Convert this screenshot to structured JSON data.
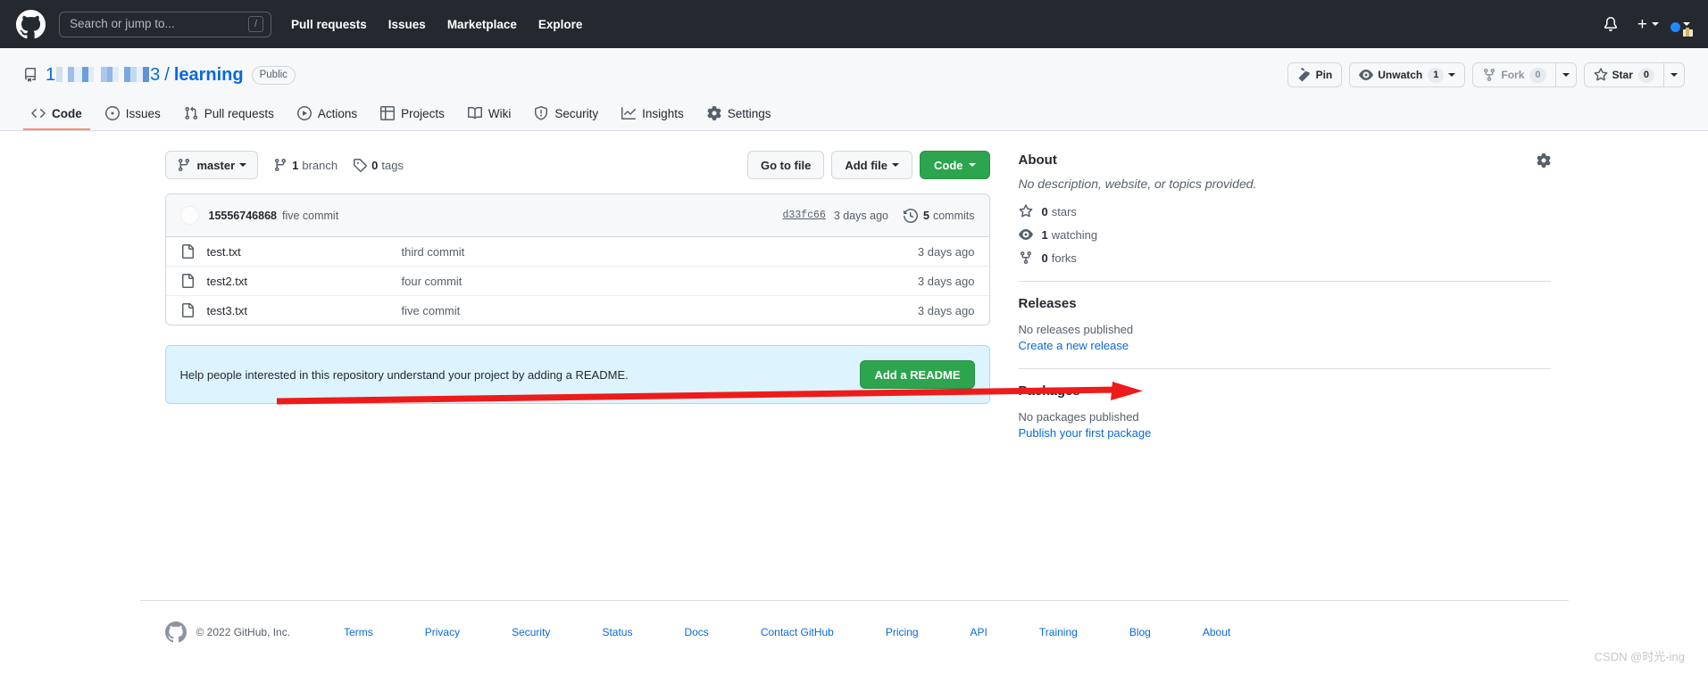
{
  "header": {
    "logo_icon": "github-mark-icon",
    "search": {
      "placeholder": "Search or jump to...",
      "value": "",
      "shortcut_key": "/"
    },
    "nav": [
      {
        "label": "Pull requests"
      },
      {
        "label": "Issues"
      },
      {
        "label": "Marketplace"
      },
      {
        "label": "Explore"
      }
    ],
    "notifications_icon": "bell-icon",
    "create_new_icon": "plus-icon",
    "create_new_caret": "chevron-down-icon",
    "avatar_icon": "user-avatar",
    "avatar_caret": "chevron-down-icon"
  },
  "repo": {
    "repo_icon": "repo-icon",
    "owner": "1███████3",
    "owner_prefix": "1",
    "owner_suffix": "3",
    "separator": "/",
    "name": "learning",
    "visibility": "Public",
    "actions": {
      "pin_label": "Pin",
      "pin_icon": "pin-icon",
      "unwatch_label": "Unwatch",
      "unwatch_icon": "eye-icon",
      "unwatch_count": "1",
      "fork_label": "Fork",
      "fork_icon": "repo-forked-icon",
      "fork_count": "0",
      "star_label": "Star",
      "star_icon": "star-icon",
      "star_count": "0"
    },
    "tabs": [
      {
        "label": "Code",
        "icon": "code-icon",
        "active": true
      },
      {
        "label": "Issues",
        "icon": "issue-opened-icon",
        "active": false
      },
      {
        "label": "Pull requests",
        "icon": "git-pull-request-icon",
        "active": false
      },
      {
        "label": "Actions",
        "icon": "play-icon",
        "active": false
      },
      {
        "label": "Projects",
        "icon": "table-icon",
        "active": false
      },
      {
        "label": "Wiki",
        "icon": "book-icon",
        "active": false
      },
      {
        "label": "Security",
        "icon": "shield-icon",
        "active": false
      },
      {
        "label": "Insights",
        "icon": "graph-icon",
        "active": false
      },
      {
        "label": "Settings",
        "icon": "gear-icon",
        "active": false
      }
    ]
  },
  "toolbar": {
    "branch_name": "master",
    "branch_icon": "git-branch-icon",
    "branch_caret": "chevron-down-icon",
    "branch_count": "1",
    "branch_count_label": "branch",
    "tag_count": "0",
    "tag_count_label": "tags",
    "tag_icon": "tag-icon",
    "go_to_file": "Go to file",
    "add_file": "Add file",
    "code_button": "Code"
  },
  "commit_bar": {
    "avatar": "commit-author-avatar",
    "author": "15556746868",
    "message": "five commit",
    "sha": "d33fc66",
    "time": "3 days ago",
    "history_icon": "history-icon",
    "commits_count": "5",
    "commits_label": "commits"
  },
  "files": [
    {
      "icon": "file-icon",
      "name": "test.txt",
      "commit": "third commit",
      "time": "3 days ago"
    },
    {
      "icon": "file-icon",
      "name": "test2.txt",
      "commit": "four commit",
      "time": "3 days ago"
    },
    {
      "icon": "file-icon",
      "name": "test3.txt",
      "commit": "five commit",
      "time": "3 days ago"
    }
  ],
  "readme_prompt": {
    "text": "Help people interested in this repository understand your project by adding a README.",
    "button": "Add a README"
  },
  "sidebar": {
    "about": {
      "title": "About",
      "gear_icon": "gear-icon",
      "description": "No description, website, or topics provided.",
      "stats": [
        {
          "icon": "star-icon",
          "count": "0",
          "label": "stars"
        },
        {
          "icon": "eye-icon",
          "count": "1",
          "label": "watching"
        },
        {
          "icon": "repo-forked-icon",
          "count": "0",
          "label": "forks"
        }
      ]
    },
    "releases": {
      "title": "Releases",
      "empty": "No releases published",
      "link": "Create a new release"
    },
    "packages": {
      "title": "Packages",
      "empty": "No packages published",
      "link": "Publish your first package"
    }
  },
  "annotation": {
    "type": "arrow",
    "color": "#ee1b1b",
    "points_to": "Releases"
  },
  "footer": {
    "logo_icon": "github-mark-icon",
    "copyright": "© 2022 GitHub, Inc.",
    "links": [
      {
        "label": "Terms"
      },
      {
        "label": "Privacy"
      },
      {
        "label": "Security"
      },
      {
        "label": "Status"
      },
      {
        "label": "Docs"
      },
      {
        "label": "Contact GitHub"
      },
      {
        "label": "Pricing"
      },
      {
        "label": "API"
      },
      {
        "label": "Training"
      },
      {
        "label": "Blog"
      },
      {
        "label": "About"
      }
    ]
  },
  "watermark": "CSDN @时光-ing"
}
